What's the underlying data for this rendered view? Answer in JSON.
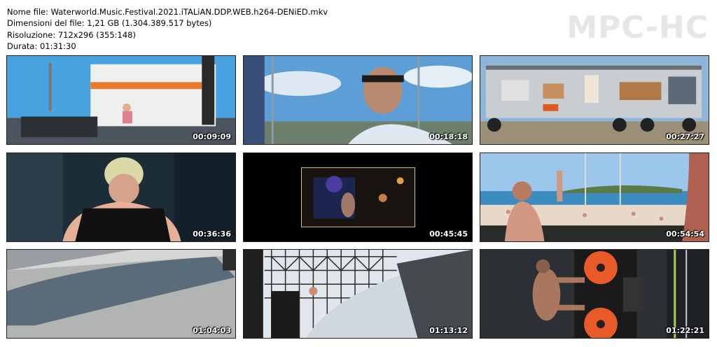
{
  "header": {
    "file_name": "Nome file: Waterworld.Music.Festival.2021.iTALiAN.DDP.WEB.h264-DENiED.mkv",
    "file_size": "Dimensioni del file: 1,21 GB (1.304.389.517 bytes)",
    "resolution": "Risoluzione: 712x296 (355:148)",
    "duration": "Durata: 01:31:30"
  },
  "logo": "MPC-HC",
  "thumbnails": [
    {
      "time": "00:09:09"
    },
    {
      "time": "00:18:18"
    },
    {
      "time": "00:27:27"
    },
    {
      "time": "00:36:36"
    },
    {
      "time": "00:45:45"
    },
    {
      "time": "00:54:54"
    },
    {
      "time": "01:04:03"
    },
    {
      "time": "01:13:12"
    },
    {
      "time": "01:22:21"
    }
  ]
}
